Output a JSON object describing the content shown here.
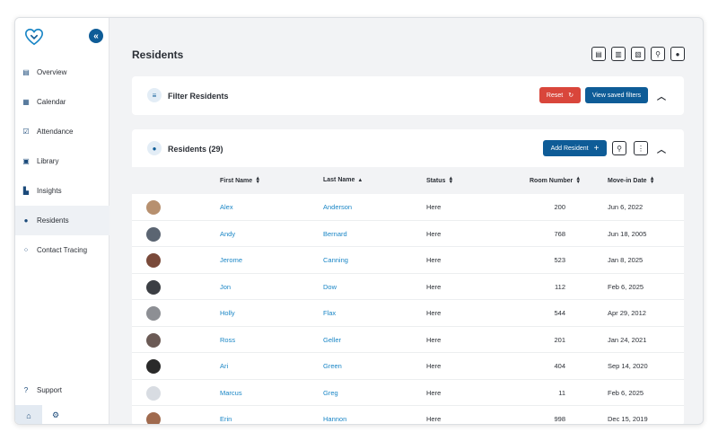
{
  "sidebar": {
    "items": [
      {
        "label": "Overview",
        "icon": "overview-icon"
      },
      {
        "label": "Calendar",
        "icon": "calendar-icon"
      },
      {
        "label": "Attendance",
        "icon": "attendance-icon"
      },
      {
        "label": "Library",
        "icon": "library-icon"
      },
      {
        "label": "Insights",
        "icon": "insights-icon"
      },
      {
        "label": "Residents",
        "icon": "user-icon",
        "active": true
      },
      {
        "label": "Contact Tracing",
        "icon": "contact-tracing-icon"
      }
    ],
    "support_label": "Support"
  },
  "header": {
    "title": "Residents"
  },
  "filter": {
    "title": "Filter Residents",
    "reset_label": "Reset",
    "saved_label": "View saved filters"
  },
  "residents": {
    "title": "Residents (29)",
    "add_label": "Add Resident",
    "columns": [
      "First Name",
      "Last Name",
      "Status",
      "Room Number",
      "Move-in Date"
    ],
    "rows": [
      {
        "first": "Alex",
        "last": "Anderson",
        "status": "Here",
        "room": "200",
        "date": "Jun 6, 2022",
        "avatar_color": "#b7906f"
      },
      {
        "first": "Andy",
        "last": "Bernard",
        "status": "Here",
        "room": "768",
        "date": "Jun 18, 2005",
        "avatar_color": "#5b6572"
      },
      {
        "first": "Jerome",
        "last": "Canning",
        "status": "Here",
        "room": "523",
        "date": "Jan 8, 2025",
        "avatar_color": "#7a4a3a"
      },
      {
        "first": "Jon",
        "last": "Dow",
        "status": "Here",
        "room": "112",
        "date": "Feb 6, 2025",
        "avatar_color": "#3c3f44"
      },
      {
        "first": "Holly",
        "last": "Flax",
        "status": "Here",
        "room": "544",
        "date": "Apr 29, 2012",
        "avatar_color": "#8d8f94"
      },
      {
        "first": "Ross",
        "last": "Geller",
        "status": "Here",
        "room": "201",
        "date": "Jan 24, 2021",
        "avatar_color": "#6b5a55"
      },
      {
        "first": "Ari",
        "last": "Green",
        "status": "Here",
        "room": "404",
        "date": "Sep 14, 2020",
        "avatar_color": "#2a2a2a"
      },
      {
        "first": "Marcus",
        "last": "Greg",
        "status": "Here",
        "room": "11",
        "date": "Feb 6, 2025",
        "avatar_color": "#d8dce2"
      },
      {
        "first": "Erin",
        "last": "Hannon",
        "status": "Here",
        "room": "998",
        "date": "Dec 15, 2019",
        "avatar_color": "#a06a4e"
      }
    ]
  },
  "colors": {
    "accent": "#0e5c97",
    "link": "#1a86c6",
    "danger": "#d9463b"
  }
}
